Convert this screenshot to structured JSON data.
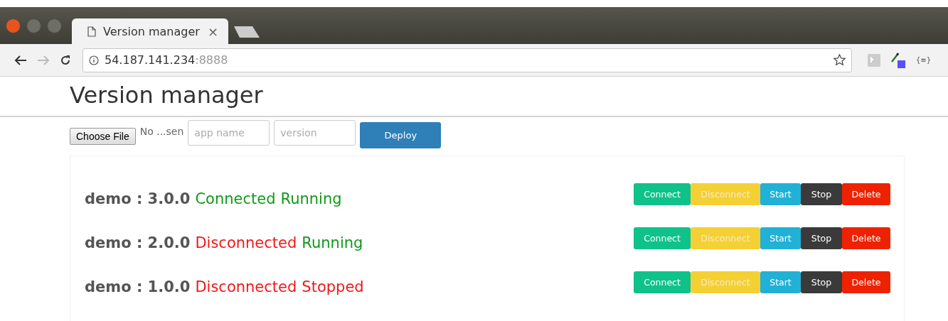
{
  "browser": {
    "tab_title": "Version manager",
    "tab_close": "×",
    "url_host": "54.187.141.234",
    "url_port": ":8888",
    "extension_label": "{≡}"
  },
  "page": {
    "title": "Version manager"
  },
  "form": {
    "file_button": "Choose File",
    "file_status": "No ...sen",
    "app_name_placeholder": "app name",
    "version_placeholder": "version",
    "deploy": "Deploy"
  },
  "versions": [
    {
      "label": "demo : 3.0.0",
      "status": [
        {
          "text": "Connected",
          "ok": true
        },
        {
          "text": "Running",
          "ok": true
        }
      ],
      "actions": [
        {
          "label": "Connect",
          "kind": "connect"
        },
        {
          "label": "Disconnect",
          "kind": "disconnect"
        },
        {
          "label": "Start",
          "kind": "start"
        },
        {
          "label": "Stop",
          "kind": "stop"
        },
        {
          "label": "Delete",
          "kind": "delete"
        }
      ]
    },
    {
      "label": "demo : 2.0.0",
      "status": [
        {
          "text": "Disconnected",
          "ok": false
        },
        {
          "text": "Running",
          "ok": true
        }
      ],
      "actions": [
        {
          "label": "Connect",
          "kind": "connect"
        },
        {
          "label": "Disconnect",
          "kind": "disconnect"
        },
        {
          "label": "Start",
          "kind": "start"
        },
        {
          "label": "Stop",
          "kind": "stop"
        },
        {
          "label": "Delete",
          "kind": "delete"
        }
      ]
    },
    {
      "label": "demo : 1.0.0",
      "status": [
        {
          "text": "Disconnected",
          "ok": false
        },
        {
          "text": "Stopped",
          "ok": false
        }
      ],
      "actions": [
        {
          "label": "Connect",
          "kind": "connect"
        },
        {
          "label": "Disconnect",
          "kind": "disconnect"
        },
        {
          "label": "Start",
          "kind": "start"
        },
        {
          "label": "Stop",
          "kind": "stop"
        },
        {
          "label": "Delete",
          "kind": "delete"
        }
      ]
    }
  ]
}
